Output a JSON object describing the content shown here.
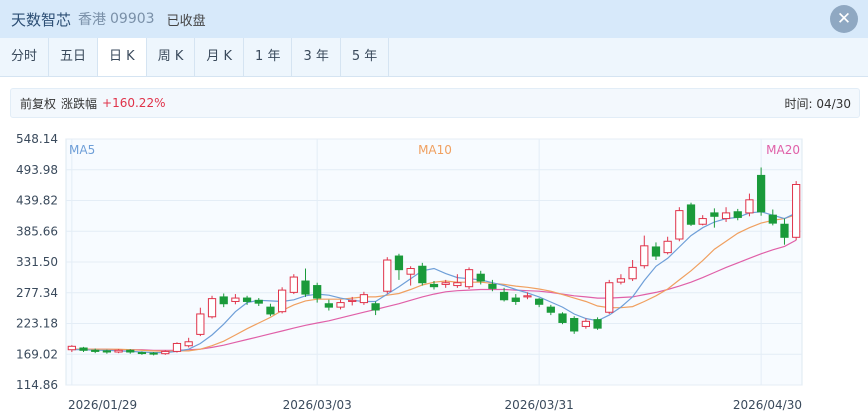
{
  "header": {
    "stock_name": "天数智芯",
    "market": "香港",
    "code": "09903",
    "status": "已收盘",
    "close_icon": "close-icon"
  },
  "tabs": [
    {
      "label": "分时",
      "active": false
    },
    {
      "label": "五日",
      "active": false
    },
    {
      "label": "日 K",
      "active": true
    },
    {
      "label": "周 K",
      "active": false
    },
    {
      "label": "月 K",
      "active": false
    },
    {
      "label": "1 年",
      "active": false
    },
    {
      "label": "3 年",
      "active": false
    },
    {
      "label": "5 年",
      "active": false
    }
  ],
  "infobar": {
    "adjust_label": "前复权",
    "change_label": "涨跌幅",
    "change_value": "+160.22%",
    "time_label": "时间: 04/30"
  },
  "colors": {
    "up": "#e0334a",
    "down": "#1a9a3a",
    "ma5": "#6f9fd8",
    "ma10": "#f0a060",
    "ma20": "#e060a8"
  },
  "chart_data": {
    "type": "candlestick",
    "ylim": [
      114.86,
      548.14
    ],
    "y_ticks": [
      "548.14",
      "493.98",
      "439.82",
      "385.66",
      "331.50",
      "277.34",
      "223.18",
      "169.02",
      "114.86"
    ],
    "x_labels": [
      "2026/01/29",
      "2026/03/03",
      "2026/03/31",
      "2026/04/30"
    ],
    "x_label_index": [
      0,
      21,
      40,
      59
    ],
    "legend": [
      "MA5",
      "MA10",
      "MA20"
    ],
    "candles": [
      [
        177,
        183,
        185,
        173
      ],
      [
        180,
        176,
        182,
        173
      ],
      [
        176,
        174,
        179,
        171
      ],
      [
        175,
        173,
        177,
        170
      ],
      [
        173,
        176,
        178,
        171
      ],
      [
        176,
        173,
        178,
        170
      ],
      [
        172,
        171,
        174,
        168
      ],
      [
        171,
        170,
        173,
        167
      ],
      [
        170,
        174,
        176,
        168
      ],
      [
        174,
        188,
        190,
        172
      ],
      [
        184,
        191,
        198,
        181
      ],
      [
        204,
        240,
        251,
        201
      ],
      [
        235,
        267,
        272,
        232
      ],
      [
        270,
        258,
        276,
        252
      ],
      [
        262,
        268,
        275,
        257
      ],
      [
        268,
        262,
        272,
        256
      ],
      [
        264,
        259,
        268,
        254
      ],
      [
        252,
        240,
        258,
        236
      ],
      [
        244,
        282,
        287,
        241
      ],
      [
        278,
        305,
        310,
        275
      ],
      [
        298,
        275,
        320,
        270
      ],
      [
        290,
        268,
        295,
        260
      ],
      [
        258,
        252,
        265,
        246
      ],
      [
        252,
        260,
        265,
        248
      ],
      [
        262,
        264,
        270,
        255
      ],
      [
        260,
        274,
        279,
        256
      ],
      [
        258,
        247,
        262,
        238
      ],
      [
        280,
        335,
        340,
        276
      ],
      [
        342,
        318,
        346,
        300
      ],
      [
        310,
        320,
        324,
        290
      ],
      [
        324,
        295,
        330,
        290
      ],
      [
        292,
        288,
        298,
        283
      ],
      [
        292,
        295,
        300,
        286
      ],
      [
        290,
        295,
        310,
        286
      ],
      [
        288,
        318,
        322,
        284
      ],
      [
        310,
        298,
        316,
        292
      ],
      [
        292,
        285,
        300,
        280
      ],
      [
        278,
        265,
        286,
        262
      ],
      [
        268,
        262,
        275,
        256
      ],
      [
        270,
        272,
        278,
        266
      ],
      [
        266,
        257,
        268,
        252
      ],
      [
        252,
        243,
        256,
        238
      ],
      [
        240,
        225,
        243,
        222
      ],
      [
        232,
        210,
        236,
        205
      ],
      [
        218,
        227,
        232,
        214
      ],
      [
        230,
        215,
        234,
        212
      ],
      [
        243,
        295,
        300,
        240
      ],
      [
        296,
        302,
        310,
        292
      ],
      [
        302,
        322,
        335,
        298
      ],
      [
        325,
        360,
        378,
        320
      ],
      [
        358,
        342,
        366,
        335
      ],
      [
        348,
        368,
        376,
        345
      ],
      [
        372,
        422,
        428,
        368
      ],
      [
        432,
        398,
        436,
        395
      ],
      [
        398,
        408,
        414,
        396
      ],
      [
        418,
        412,
        426,
        392
      ],
      [
        408,
        418,
        428,
        402
      ],
      [
        420,
        410,
        425,
        405
      ],
      [
        418,
        441,
        452,
        412
      ],
      [
        484,
        420,
        498,
        413
      ],
      [
        414,
        400,
        424,
        396
      ],
      [
        398,
        375,
        408,
        362
      ],
      [
        375,
        468,
        474,
        370
      ]
    ],
    "ma5": [
      177,
      177,
      176,
      176,
      175,
      174,
      173,
      172,
      172,
      174,
      178,
      188,
      203,
      222,
      244,
      260,
      264,
      263,
      262,
      265,
      272,
      275,
      273,
      268,
      264,
      262,
      262,
      275,
      288,
      302,
      316,
      320,
      311,
      304,
      302,
      300,
      295,
      290,
      283,
      277,
      270,
      261,
      252,
      240,
      232,
      228,
      238,
      252,
      270,
      299,
      324,
      338,
      358,
      378,
      392,
      402,
      408,
      410,
      418,
      420,
      414,
      408,
      418
    ],
    "ma10": [
      178,
      178,
      178,
      178,
      178,
      177,
      176,
      175,
      174,
      175,
      175,
      178,
      184,
      192,
      203,
      214,
      224,
      234,
      246,
      256,
      263,
      266,
      266,
      266,
      268,
      270,
      270,
      273,
      276,
      283,
      291,
      296,
      298,
      296,
      296,
      296,
      294,
      292,
      289,
      287,
      284,
      280,
      274,
      268,
      262,
      254,
      251,
      251,
      253,
      262,
      272,
      284,
      300,
      316,
      334,
      354,
      368,
      382,
      392,
      400,
      405,
      408,
      415
    ],
    "ma20": [
      178,
      178,
      178,
      178,
      177,
      177,
      177,
      176,
      176,
      176,
      177,
      178,
      181,
      185,
      190,
      195,
      200,
      205,
      210,
      215,
      220,
      224,
      228,
      233,
      238,
      243,
      248,
      253,
      258,
      264,
      270,
      275,
      279,
      281,
      282,
      283,
      283,
      283,
      282,
      281,
      280,
      278,
      275,
      272,
      270,
      268,
      268,
      269,
      270,
      274,
      278,
      283,
      289,
      296,
      304,
      313,
      322,
      330,
      338,
      346,
      353,
      359,
      370
    ]
  }
}
